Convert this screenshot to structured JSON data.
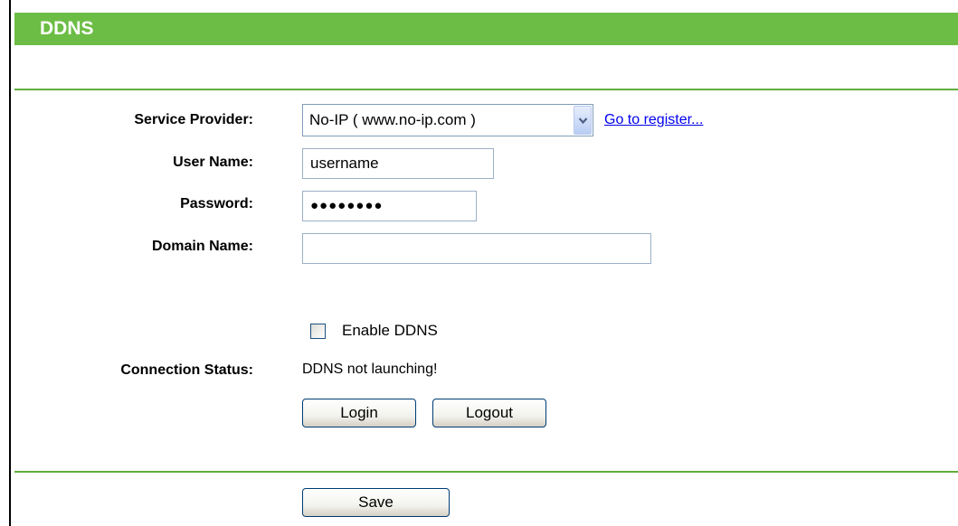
{
  "header": {
    "title": "DDNS"
  },
  "form": {
    "service_provider": {
      "label": "Service Provider:",
      "selected": "No-IP ( www.no-ip.com )",
      "register_link": "Go to register..."
    },
    "user_name": {
      "label": "User Name:",
      "value": "username"
    },
    "password": {
      "label": "Password:",
      "value": "●●●●●●●●"
    },
    "domain_name": {
      "label": "Domain Name:",
      "value": ""
    },
    "enable_ddns": {
      "label": "Enable DDNS",
      "checked": false
    },
    "connection_status": {
      "label": "Connection Status:",
      "value": "DDNS not launching!"
    }
  },
  "buttons": {
    "login": "Login",
    "logout": "Logout",
    "save": "Save"
  },
  "colors": {
    "title_bar": "#6cbd45",
    "divider": "#5fae3c",
    "link": "#0000ee"
  },
  "icons": {
    "dropdown": "chevron-down-icon"
  }
}
